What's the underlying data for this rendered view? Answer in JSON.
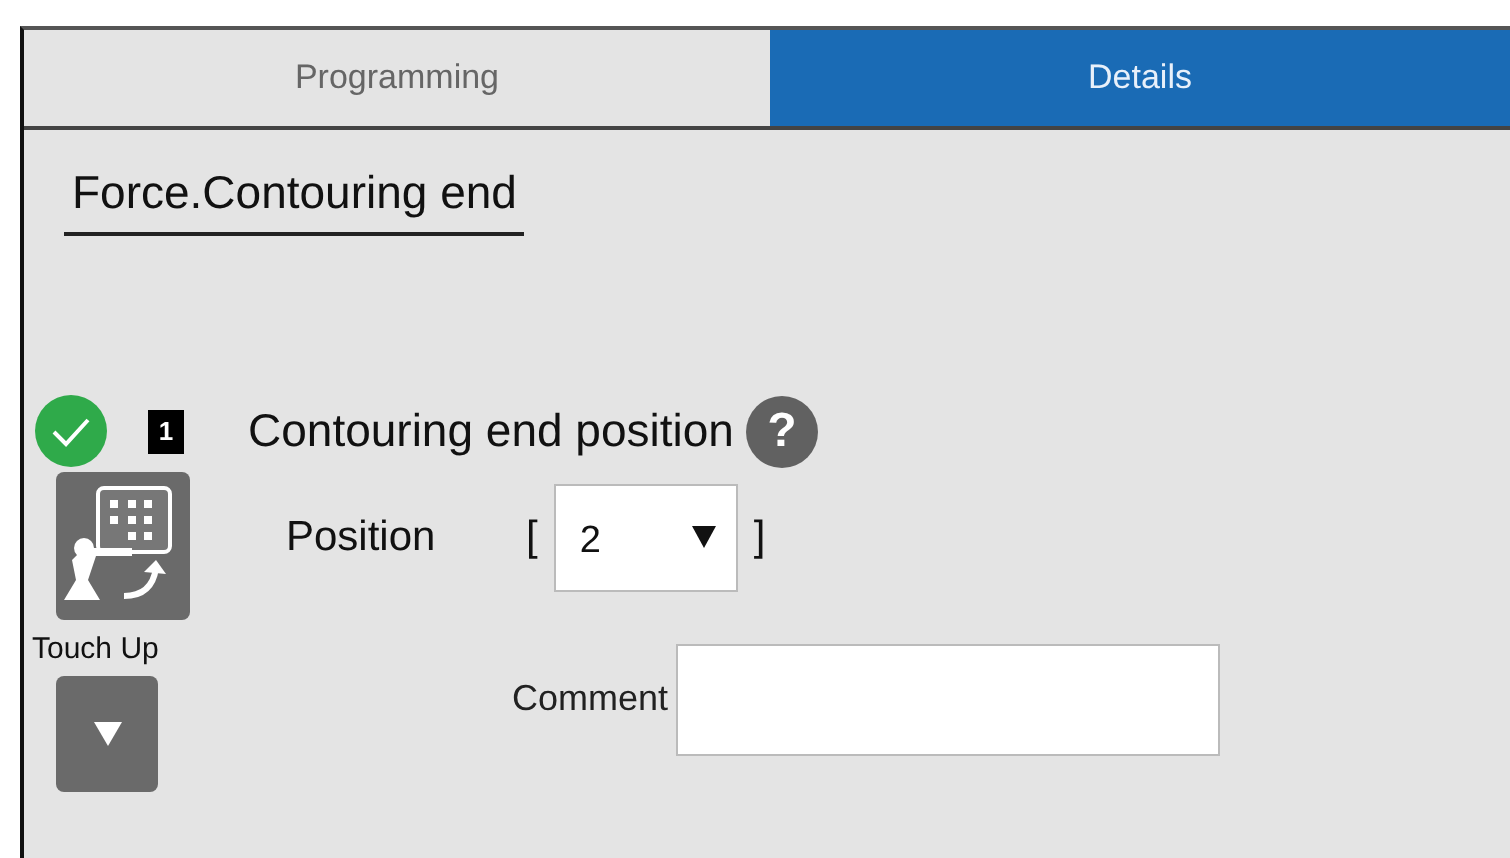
{
  "tabs": [
    {
      "label": "Programming",
      "selected": false
    },
    {
      "label": "Details",
      "selected": true
    }
  ],
  "title": "Force.Contouring end",
  "instruction": {
    "done": true,
    "number": "1",
    "label": "Contouring end position",
    "help": "?"
  },
  "touch_up": {
    "label": "Touch Up"
  },
  "position": {
    "label": "Position",
    "open_bracket": "[",
    "value": "2",
    "close_bracket": "]"
  },
  "comment": {
    "label": "Comment"
  }
}
